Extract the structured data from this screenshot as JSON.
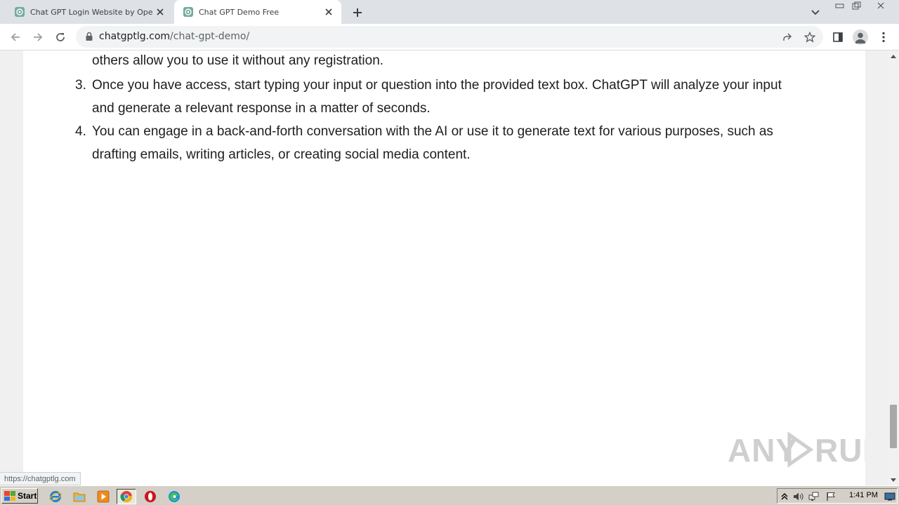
{
  "browser": {
    "tabs": [
      {
        "title": "Chat GPT Login Website by OpenAI,",
        "active": false,
        "icon": "openai-logo-icon"
      },
      {
        "title": "Chat GPT Demo Free",
        "active": true,
        "icon": "openai-logo-icon"
      }
    ],
    "address": {
      "domain": "chatgptlg.com",
      "path": "/chat-gpt-demo/"
    }
  },
  "page": {
    "partial_line": "others allow you to use it without any registration.",
    "list": [
      {
        "num": "3.",
        "lines": [
          "Once you have access, start typing your input or question into the provided text box. ChatGPT will analyze your input",
          "and generate a relevant response in a matter of seconds."
        ]
      },
      {
        "num": "4.",
        "lines": [
          "You can engage in a back-and-forth conversation with the AI or use it to generate text for various purposes, such as",
          "drafting emails, writing articles, or creating social media content."
        ]
      }
    ]
  },
  "status_url": "https://chatgptlg.com",
  "watermark": "ANY RUN",
  "taskbar": {
    "start_label": "Start",
    "clock": "1:41 PM"
  },
  "colors": {
    "tabstrip": "#dee1e6",
    "taskbar": "#d4d0c8",
    "text": "#1e1e1e"
  }
}
